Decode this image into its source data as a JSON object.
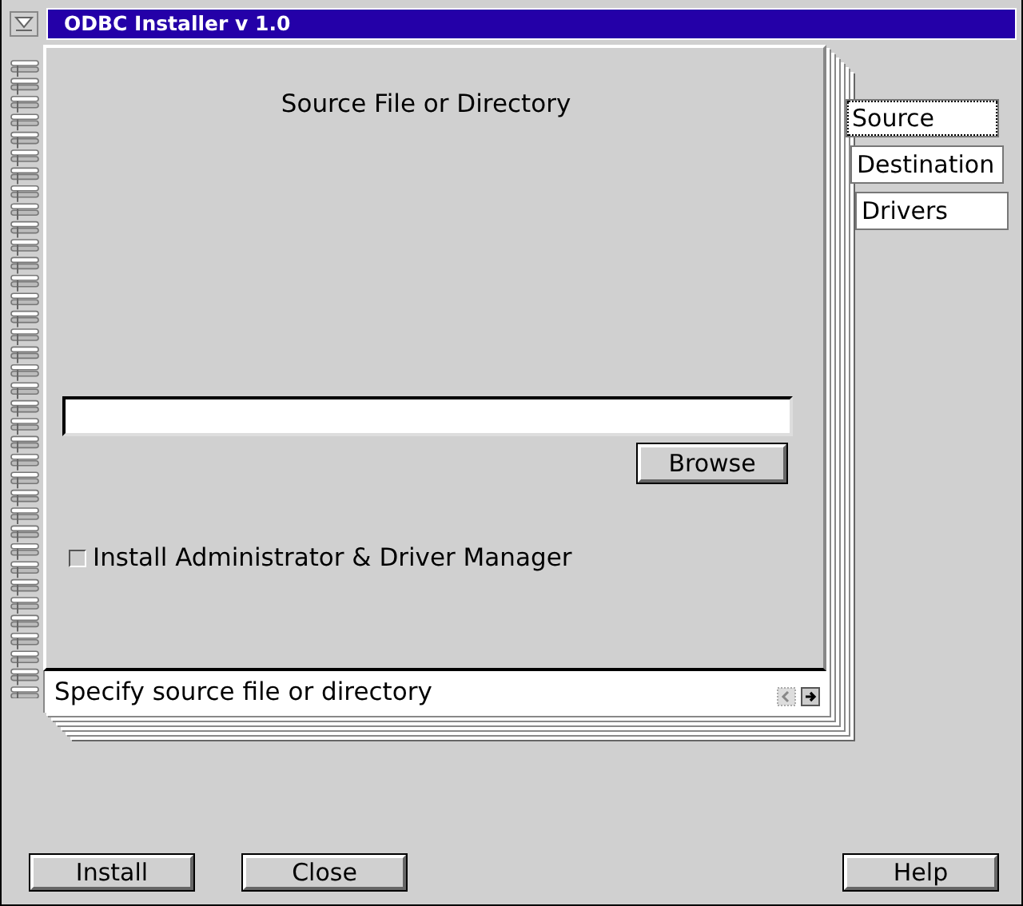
{
  "window": {
    "title": "ODBC Installer  v 1.0"
  },
  "page": {
    "heading": "Source File or Directory",
    "browse_button": "Browse",
    "checkbox": {
      "label": "Install Administrator & Driver Manager",
      "checked": false
    }
  },
  "status_line": "Specify source file or directory",
  "tabs": [
    {
      "label": "Source",
      "selected": true
    },
    {
      "label": "Destination",
      "selected": false
    },
    {
      "label": "Drivers",
      "selected": false
    }
  ],
  "buttons": [
    "Install",
    "Close",
    "Help"
  ]
}
